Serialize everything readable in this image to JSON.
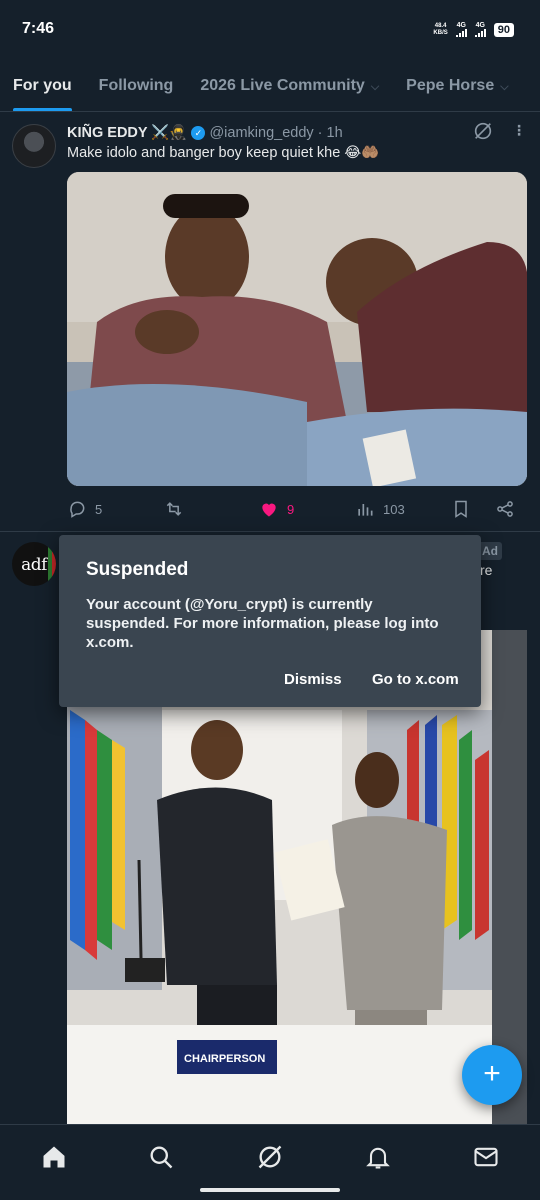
{
  "status_bar": {
    "time": "7:46",
    "speed_value": "48.4",
    "speed_unit": "KB/S",
    "net1": "4G",
    "net2": "4G",
    "battery": "90"
  },
  "tabs": [
    {
      "label": "For you",
      "active": true
    },
    {
      "label": "Following",
      "active": false
    },
    {
      "label": "2026 Live Community",
      "active": false
    },
    {
      "label": "Pepe Horse",
      "active": false
    }
  ],
  "tweet1": {
    "name": "KIÑG EDDY ⚔️🥷",
    "handle": "@iamking_eddy",
    "time": "· 1h",
    "text": "Make idolo and banger boy keep quiet khe 😂🤲🏽",
    "replies": "5",
    "likes": "9",
    "views": "103"
  },
  "tweet2": {
    "logo_text": "adf",
    "ad_label": "Ad",
    "ad_text_fragment": "re",
    "plaque_text": "CHAIRPERSON"
  },
  "dialog": {
    "title": "Suspended",
    "message": "Your account (@Yoru_crypt) is currently suspended. For more information, please log into x.com.",
    "dismiss": "Dismiss",
    "goto": "Go to x.com"
  },
  "fab": {
    "label": "+"
  },
  "nav": [
    "home-icon",
    "search-icon",
    "grok-icon",
    "notifications-icon",
    "messages-icon"
  ],
  "colors": {
    "accent": "#1d9bf0",
    "like": "#f91880",
    "background": "#15202b",
    "dialog": "#3a4550"
  }
}
